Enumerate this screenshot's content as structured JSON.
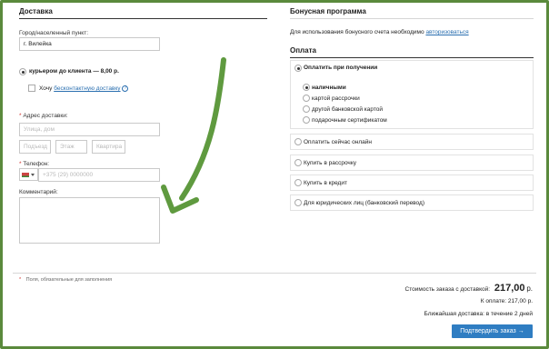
{
  "delivery": {
    "title": "Доставка",
    "city_label": "Город/населенный пункт:",
    "city_value": "г. Вилейка",
    "courier_option": "курьером до клиента — 8,00 р.",
    "want_prefix": "Хочу",
    "want_link": "бесконтактную доставку",
    "address_label": "Адрес доставки:",
    "street_placeholder": "Улица, дом",
    "entrance_placeholder": "Подъезд",
    "floor_placeholder": "Этаж",
    "apartment_placeholder": "Квартира",
    "phone_label": "Телефон:",
    "phone_placeholder": "+375 (29) 0000000",
    "comment_label": "Комментарий:",
    "required_star": "*",
    "required_note": "Поля, обязательные для заполнения"
  },
  "bonus": {
    "title": "Бонусная программа",
    "text": "Для использования бонусного счета необходимо",
    "link": "авторизоваться"
  },
  "payment": {
    "title": "Оплата",
    "on_receipt": "Оплатить при получении",
    "sub_options": [
      "наличными",
      "картой рассрочки",
      "другой банковской картой",
      "подарочным сертификатом"
    ],
    "other_options": [
      "Оплатить сейчас онлайн",
      "Купить в рассрочку",
      "Купить в кредит",
      "Для юридических лиц (банковский перевод)"
    ]
  },
  "summary": {
    "total_label": "Стоимость заказа с доставкой:",
    "total_value": "217,00",
    "total_unit": "р.",
    "to_pay_label": "К оплате:",
    "to_pay_value": "217,00 р.",
    "nearest_label": "Ближайшая доставка:",
    "nearest_value": "в течение 2 дней",
    "confirm_button": "Подтвердить заказ →"
  },
  "colors": {
    "frame": "#5a8a3c",
    "arrow": "#5f9a3f",
    "button": "#2f7dc2",
    "link": "#2a6fb0",
    "required": "#d0312d"
  },
  "icons": [
    "flag-icon",
    "question-icon",
    "arrow-annotation-icon"
  ]
}
